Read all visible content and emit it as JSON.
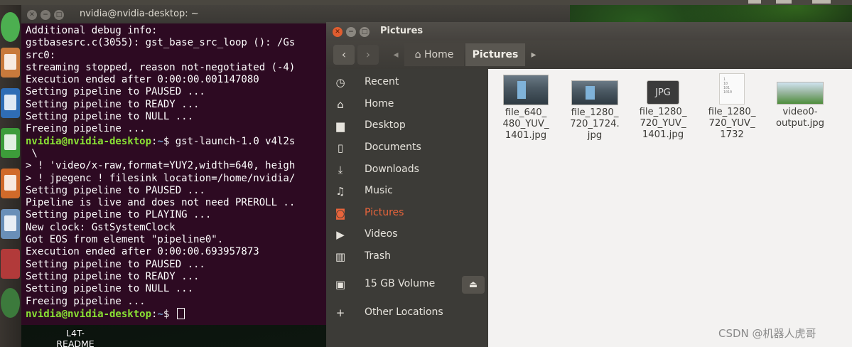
{
  "terminal": {
    "title": "nvidia@nvidia-desktop: ~",
    "lines": [
      [
        {
          "t": "Additional debug info:",
          "c": "txt"
        }
      ],
      [
        {
          "t": "gstbasesrc.c(3055): gst_base_src_loop (): /Gs",
          "c": "txt"
        }
      ],
      [
        {
          "t": "src0:",
          "c": "txt"
        }
      ],
      [
        {
          "t": "streaming stopped, reason not-negotiated (-4)",
          "c": "txt"
        }
      ],
      [
        {
          "t": "Execution ended after 0:00:00.001147080",
          "c": "txt"
        }
      ],
      [
        {
          "t": "Setting pipeline to PAUSED ...",
          "c": "txt"
        }
      ],
      [
        {
          "t": "Setting pipeline to READY ...",
          "c": "txt"
        }
      ],
      [
        {
          "t": "Setting pipeline to NULL ...",
          "c": "txt"
        }
      ],
      [
        {
          "t": "Freeing pipeline ...",
          "c": "txt"
        }
      ],
      [
        {
          "t": "nvidia@nvidia-desktop",
          "c": "user"
        },
        {
          "t": ":",
          "c": "txt"
        },
        {
          "t": "~",
          "c": "path"
        },
        {
          "t": "$ gst-launch-1.0 v4l2s",
          "c": "txt"
        }
      ],
      [
        {
          "t": " \\",
          "c": "txt"
        }
      ],
      [
        {
          "t": "> ! 'video/x-raw,format=YUY2,width=640, heigh",
          "c": "txt"
        }
      ],
      [
        {
          "t": "> ! jpegenc ! filesink location=/home/nvidia/",
          "c": "txt"
        }
      ],
      [
        {
          "t": "Setting pipeline to PAUSED ...",
          "c": "txt"
        }
      ],
      [
        {
          "t": "Pipeline is live and does not need PREROLL ..",
          "c": "txt"
        }
      ],
      [
        {
          "t": "Setting pipeline to PLAYING ...",
          "c": "txt"
        }
      ],
      [
        {
          "t": "New clock: GstSystemClock",
          "c": "txt"
        }
      ],
      [
        {
          "t": "Got EOS from element \"pipeline0\".",
          "c": "txt"
        }
      ],
      [
        {
          "t": "Execution ended after 0:00:00.693957873",
          "c": "txt"
        }
      ],
      [
        {
          "t": "Setting pipeline to PAUSED ...",
          "c": "txt"
        }
      ],
      [
        {
          "t": "Setting pipeline to READY ...",
          "c": "txt"
        }
      ],
      [
        {
          "t": "Setting pipeline to NULL ...",
          "c": "txt"
        }
      ],
      [
        {
          "t": "Freeing pipeline ...",
          "c": "txt"
        }
      ],
      [
        {
          "t": "nvidia@nvidia-desktop",
          "c": "user"
        },
        {
          "t": ":",
          "c": "txt"
        },
        {
          "t": "~",
          "c": "path"
        },
        {
          "t": "$ ",
          "c": "txt"
        },
        {
          "t": "",
          "c": "cursor"
        }
      ]
    ]
  },
  "files": {
    "title": "Pictures",
    "back_icon": "chevron-left-icon",
    "forward_icon": "chevron-right-icon",
    "path": [
      {
        "label": "Home",
        "icon": "home-icon"
      },
      {
        "label": "Pictures",
        "icon": ""
      }
    ],
    "sidebar": [
      {
        "label": "Recent",
        "icon": "clock-icon",
        "glyph": "◷"
      },
      {
        "label": "Home",
        "icon": "home-icon",
        "glyph": "⌂"
      },
      {
        "label": "Desktop",
        "icon": "folder-icon",
        "glyph": "▆"
      },
      {
        "label": "Documents",
        "icon": "document-icon",
        "glyph": "▯"
      },
      {
        "label": "Downloads",
        "icon": "download-icon",
        "glyph": "⤓"
      },
      {
        "label": "Music",
        "icon": "music-icon",
        "glyph": "♫"
      },
      {
        "label": "Pictures",
        "icon": "camera-icon",
        "glyph": "◙",
        "active": true
      },
      {
        "label": "Videos",
        "icon": "video-icon",
        "glyph": "▶"
      },
      {
        "label": "Trash",
        "icon": "trash-icon",
        "glyph": "▥"
      },
      {
        "label": "15 GB Volume",
        "icon": "drive-icon",
        "glyph": "▣",
        "eject": true
      },
      {
        "label": "Other Locations",
        "icon": "plus-icon",
        "glyph": "+"
      }
    ],
    "eject_icon": "eject-icon",
    "file_items": [
      {
        "label": "file_640_\n480_YUV_\n1401.jpg",
        "thumb": "photo"
      },
      {
        "label": "file_1280_\n720_1724.\njpg",
        "thumb": "photo"
      },
      {
        "label": "file_1280_\n720_YUV_\n1401.jpg",
        "thumb": "jpg",
        "badge": "JPG"
      },
      {
        "label": "file_1280_\n720_YUV_\n1732",
        "thumb": "binary",
        "badge": "1\n10\n101\n1010"
      },
      {
        "label": "video0-\noutput.jpg",
        "thumb": "green"
      }
    ]
  },
  "desktop_item": {
    "label": "L4T-\nREADME"
  },
  "watermark": "CSDN @机器人虎哥",
  "colors": {
    "terminal_bg": "#2d0a22",
    "prompt_user": "#8ae234",
    "prompt_path": "#729fcf",
    "sidebar_bg": "#3c3b37",
    "accent": "#e8643b",
    "close_button": "#e05d30"
  }
}
